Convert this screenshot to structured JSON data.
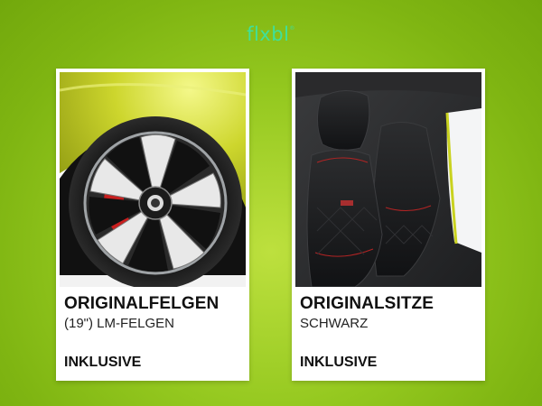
{
  "brand": {
    "logo_text": "flxbl",
    "logo_mark": "®",
    "logo_color": "#3fe09a"
  },
  "page": {
    "background_color": "#8ec21a"
  },
  "cards": [
    {
      "image_subject": "wheel-rim",
      "title": "ORIGINALFELGEN",
      "subtitle": "(19\") LM-FELGEN",
      "status": "INKLUSIVE"
    },
    {
      "image_subject": "car-seats",
      "title": "ORIGINALSITZE",
      "subtitle": "SCHWARZ",
      "status": "INKLUSIVE"
    }
  ]
}
